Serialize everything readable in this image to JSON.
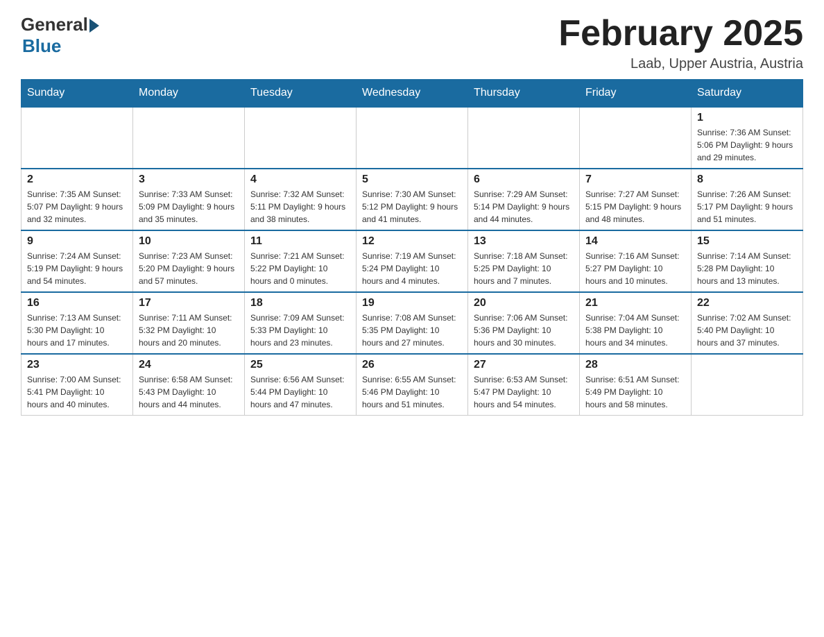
{
  "header": {
    "logo": {
      "general": "General",
      "blue": "Blue"
    },
    "title": "February 2025",
    "location": "Laab, Upper Austria, Austria"
  },
  "days_of_week": [
    "Sunday",
    "Monday",
    "Tuesday",
    "Wednesday",
    "Thursday",
    "Friday",
    "Saturday"
  ],
  "weeks": [
    [
      {
        "day": "",
        "info": ""
      },
      {
        "day": "",
        "info": ""
      },
      {
        "day": "",
        "info": ""
      },
      {
        "day": "",
        "info": ""
      },
      {
        "day": "",
        "info": ""
      },
      {
        "day": "",
        "info": ""
      },
      {
        "day": "1",
        "info": "Sunrise: 7:36 AM\nSunset: 5:06 PM\nDaylight: 9 hours and 29 minutes."
      }
    ],
    [
      {
        "day": "2",
        "info": "Sunrise: 7:35 AM\nSunset: 5:07 PM\nDaylight: 9 hours and 32 minutes."
      },
      {
        "day": "3",
        "info": "Sunrise: 7:33 AM\nSunset: 5:09 PM\nDaylight: 9 hours and 35 minutes."
      },
      {
        "day": "4",
        "info": "Sunrise: 7:32 AM\nSunset: 5:11 PM\nDaylight: 9 hours and 38 minutes."
      },
      {
        "day": "5",
        "info": "Sunrise: 7:30 AM\nSunset: 5:12 PM\nDaylight: 9 hours and 41 minutes."
      },
      {
        "day": "6",
        "info": "Sunrise: 7:29 AM\nSunset: 5:14 PM\nDaylight: 9 hours and 44 minutes."
      },
      {
        "day": "7",
        "info": "Sunrise: 7:27 AM\nSunset: 5:15 PM\nDaylight: 9 hours and 48 minutes."
      },
      {
        "day": "8",
        "info": "Sunrise: 7:26 AM\nSunset: 5:17 PM\nDaylight: 9 hours and 51 minutes."
      }
    ],
    [
      {
        "day": "9",
        "info": "Sunrise: 7:24 AM\nSunset: 5:19 PM\nDaylight: 9 hours and 54 minutes."
      },
      {
        "day": "10",
        "info": "Sunrise: 7:23 AM\nSunset: 5:20 PM\nDaylight: 9 hours and 57 minutes."
      },
      {
        "day": "11",
        "info": "Sunrise: 7:21 AM\nSunset: 5:22 PM\nDaylight: 10 hours and 0 minutes."
      },
      {
        "day": "12",
        "info": "Sunrise: 7:19 AM\nSunset: 5:24 PM\nDaylight: 10 hours and 4 minutes."
      },
      {
        "day": "13",
        "info": "Sunrise: 7:18 AM\nSunset: 5:25 PM\nDaylight: 10 hours and 7 minutes."
      },
      {
        "day": "14",
        "info": "Sunrise: 7:16 AM\nSunset: 5:27 PM\nDaylight: 10 hours and 10 minutes."
      },
      {
        "day": "15",
        "info": "Sunrise: 7:14 AM\nSunset: 5:28 PM\nDaylight: 10 hours and 13 minutes."
      }
    ],
    [
      {
        "day": "16",
        "info": "Sunrise: 7:13 AM\nSunset: 5:30 PM\nDaylight: 10 hours and 17 minutes."
      },
      {
        "day": "17",
        "info": "Sunrise: 7:11 AM\nSunset: 5:32 PM\nDaylight: 10 hours and 20 minutes."
      },
      {
        "day": "18",
        "info": "Sunrise: 7:09 AM\nSunset: 5:33 PM\nDaylight: 10 hours and 23 minutes."
      },
      {
        "day": "19",
        "info": "Sunrise: 7:08 AM\nSunset: 5:35 PM\nDaylight: 10 hours and 27 minutes."
      },
      {
        "day": "20",
        "info": "Sunrise: 7:06 AM\nSunset: 5:36 PM\nDaylight: 10 hours and 30 minutes."
      },
      {
        "day": "21",
        "info": "Sunrise: 7:04 AM\nSunset: 5:38 PM\nDaylight: 10 hours and 34 minutes."
      },
      {
        "day": "22",
        "info": "Sunrise: 7:02 AM\nSunset: 5:40 PM\nDaylight: 10 hours and 37 minutes."
      }
    ],
    [
      {
        "day": "23",
        "info": "Sunrise: 7:00 AM\nSunset: 5:41 PM\nDaylight: 10 hours and 40 minutes."
      },
      {
        "day": "24",
        "info": "Sunrise: 6:58 AM\nSunset: 5:43 PM\nDaylight: 10 hours and 44 minutes."
      },
      {
        "day": "25",
        "info": "Sunrise: 6:56 AM\nSunset: 5:44 PM\nDaylight: 10 hours and 47 minutes."
      },
      {
        "day": "26",
        "info": "Sunrise: 6:55 AM\nSunset: 5:46 PM\nDaylight: 10 hours and 51 minutes."
      },
      {
        "day": "27",
        "info": "Sunrise: 6:53 AM\nSunset: 5:47 PM\nDaylight: 10 hours and 54 minutes."
      },
      {
        "day": "28",
        "info": "Sunrise: 6:51 AM\nSunset: 5:49 PM\nDaylight: 10 hours and 58 minutes."
      },
      {
        "day": "",
        "info": ""
      }
    ]
  ]
}
